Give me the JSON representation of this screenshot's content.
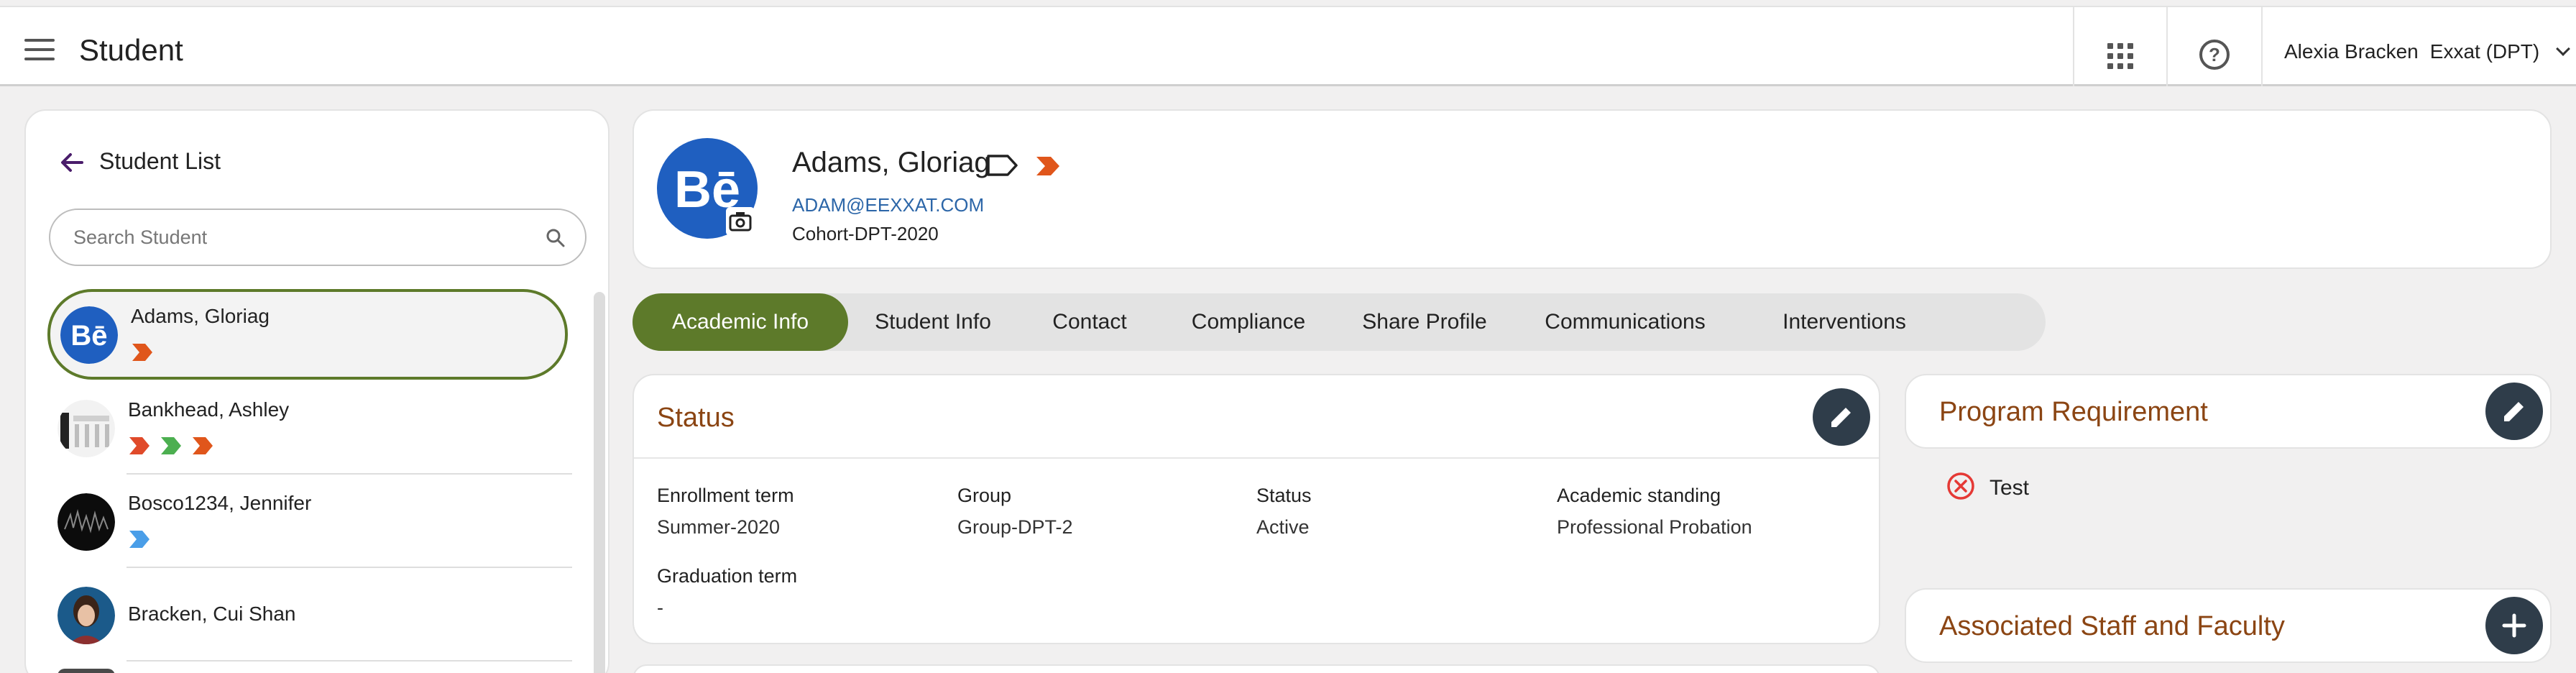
{
  "app": {
    "title": "Student"
  },
  "header": {
    "user_name": "Alexia Bracken",
    "org": "Exxat (DPT)"
  },
  "sidebar": {
    "title": "Student List",
    "search_placeholder": "Search Student",
    "students": [
      {
        "name": "Adams, Gloriag",
        "selected": true,
        "flags": [
          "orange"
        ],
        "avatar": "behance-logo"
      },
      {
        "name": "Bankhead, Ashley",
        "selected": false,
        "flags": [
          "red",
          "green",
          "orange"
        ],
        "avatar": "building-photo"
      },
      {
        "name": "Bosco1234, Jennifer",
        "selected": false,
        "flags": [
          "blue"
        ],
        "avatar": "dark-photo"
      },
      {
        "name": "Bracken, Cui Shan",
        "selected": false,
        "flags": [],
        "avatar": "person-photo"
      }
    ]
  },
  "profile": {
    "name": "Adams, Gloriag",
    "email": "ADAM@EEXXAT.COM",
    "cohort": "Cohort-DPT-2020",
    "avatar_text": "Bē"
  },
  "tabs": [
    {
      "label": "Academic Info",
      "active": true
    },
    {
      "label": "Student Info",
      "active": false
    },
    {
      "label": "Contact",
      "active": false
    },
    {
      "label": "Compliance",
      "active": false
    },
    {
      "label": "Share Profile",
      "active": false
    },
    {
      "label": "Communications",
      "active": false
    },
    {
      "label": "Interventions",
      "active": false
    }
  ],
  "status_card": {
    "title": "Status",
    "fields": [
      {
        "label": "Enrollment term",
        "value": "Summer-2020"
      },
      {
        "label": "Group",
        "value": "Group-DPT-2"
      },
      {
        "label": "Status",
        "value": "Active"
      },
      {
        "label": "Academic standing",
        "value": "Professional Probation"
      },
      {
        "label": "Graduation term",
        "value": "-"
      }
    ]
  },
  "program_requirement": {
    "title": "Program Requirement",
    "items": [
      {
        "label": "Test",
        "status": "failed"
      }
    ]
  },
  "staff_card": {
    "title": "Associated Staff and Faculty"
  },
  "colors": {
    "accent_green": "#5d7a2a",
    "title_brown": "#8b4513",
    "flag_orange": "#e0561b",
    "flag_red": "#e04a2a",
    "flag_green": "#4caf50",
    "flag_blue": "#4a9ee8",
    "link_blue": "#2c66a8",
    "edit_button": "#2f3d4a",
    "error_red": "#e53935"
  }
}
